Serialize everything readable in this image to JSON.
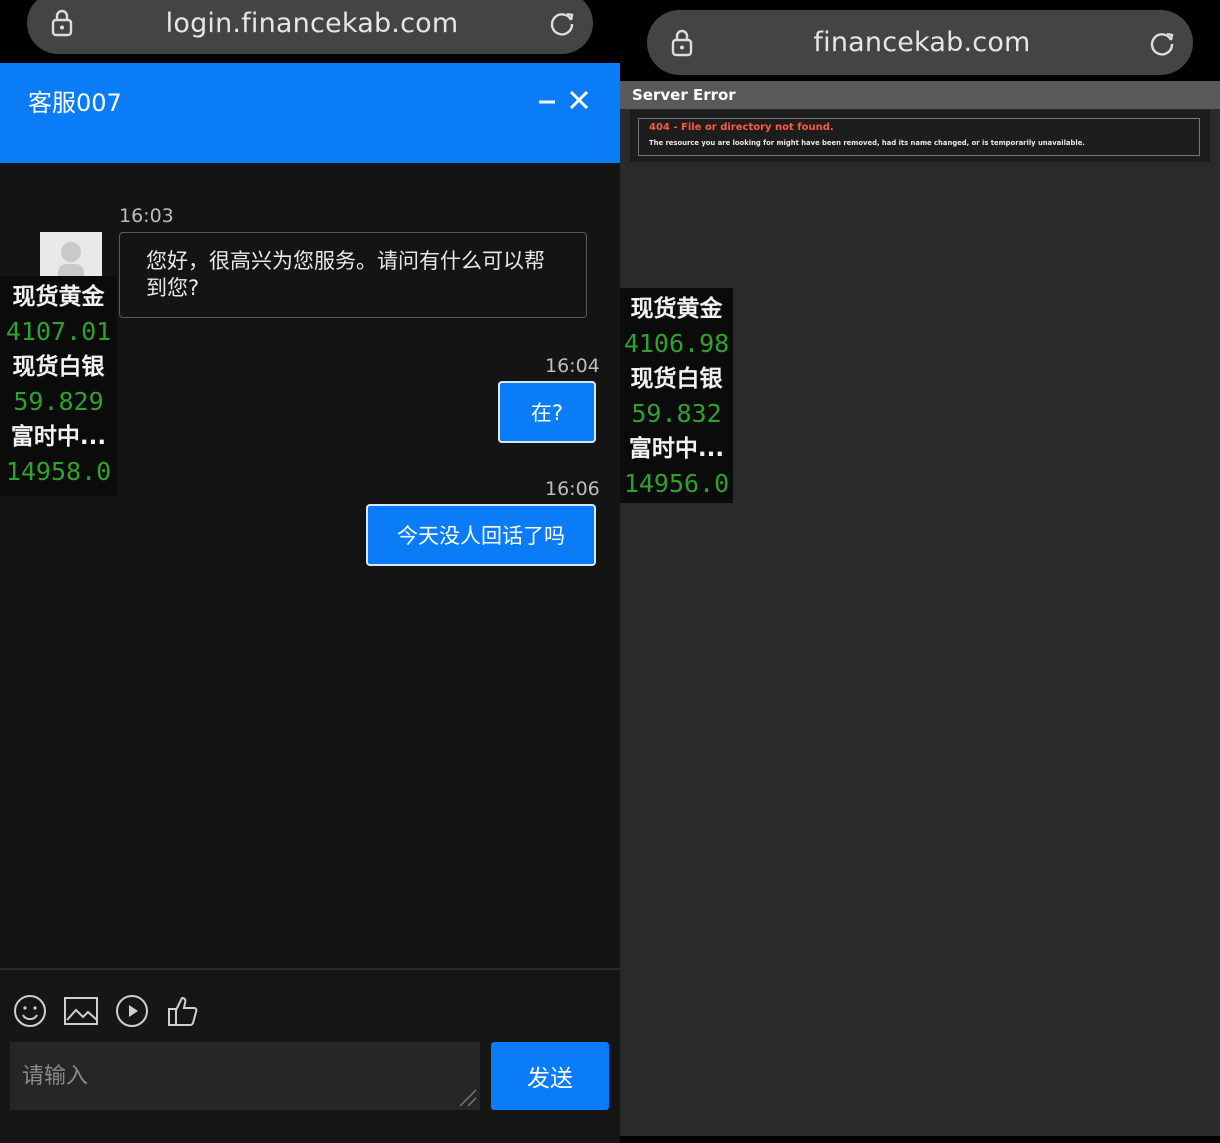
{
  "left": {
    "url": "login.financekab.com",
    "chat": {
      "title": "客服007",
      "messages": [
        {
          "time": "16:03",
          "text": "您好，很高兴为您服务。请问有什么可以帮到您?"
        },
        {
          "time": "16:04",
          "text": "在?"
        },
        {
          "time": "16:06",
          "text": "今天没人回话了吗"
        }
      ]
    },
    "ticker": [
      {
        "name": "现货黄金",
        "price": "4107.01"
      },
      {
        "name": "现货白银",
        "price": "59.829"
      },
      {
        "name": "富时中...",
        "price": "14958.0"
      }
    ],
    "input_placeholder": "请输入",
    "send_label": "发送"
  },
  "right": {
    "url": "financekab.com",
    "error_header": "Server Error",
    "error_title": "404 - File or directory not found.",
    "error_message": "The resource you are looking for might have been removed, had its name changed, or is temporarily unavailable.",
    "ticker": [
      {
        "name": "现货黄金",
        "price": "4106.98"
      },
      {
        "name": "现货白银",
        "price": "59.832"
      },
      {
        "name": "富时中...",
        "price": "14956.0"
      }
    ]
  },
  "colors": {
    "accent": "#0a7cf7",
    "price_green": "#2ea12e",
    "error_red": "#ff5a3c"
  }
}
